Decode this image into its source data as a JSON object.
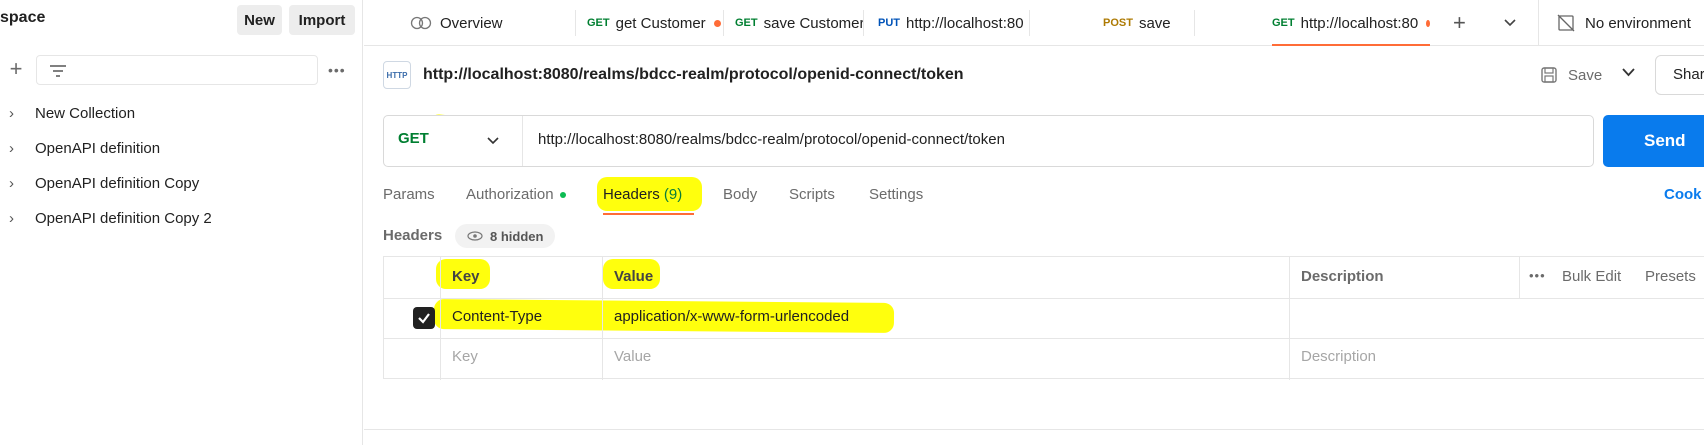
{
  "sidebar": {
    "workspace_title": "space",
    "new_label": "New",
    "import_label": "Import",
    "collections": [
      {
        "label": "New Collection"
      },
      {
        "label": "OpenAPI definition"
      },
      {
        "label": "OpenAPI definition Copy"
      },
      {
        "label": "OpenAPI definition Copy 2"
      }
    ]
  },
  "tabs": [
    {
      "method": "",
      "label": "Overview",
      "unsaved": false
    },
    {
      "method": "GET",
      "label": "get Customer",
      "unsaved": true
    },
    {
      "method": "GET",
      "label": "save Customer",
      "unsaved": true
    },
    {
      "method": "PUT",
      "label": "http://localhost:80",
      "unsaved": true
    },
    {
      "method": "POST",
      "label": "save",
      "unsaved": true
    },
    {
      "method": "GET",
      "label": "http://localhost:80",
      "unsaved": true,
      "active": true
    }
  ],
  "environment": "No environment",
  "request": {
    "icon_text": "HTTP",
    "title": "http://localhost:8080/realms/bdcc-realm/protocol/openid-connect/token",
    "save_label": "Save",
    "share_label": "Shar",
    "method": "GET",
    "url": "http://localhost:8080/realms/bdcc-realm/protocol/openid-connect/token",
    "send_label": "Send"
  },
  "subtabs": {
    "params": "Params",
    "authorization": "Authorization",
    "headers": "Headers",
    "headers_count": "(9)",
    "body": "Body",
    "scripts": "Scripts",
    "settings": "Settings",
    "cookies": "Cook"
  },
  "headers_section": {
    "label": "Headers",
    "hidden": "8 hidden",
    "columns": {
      "key": "Key",
      "value": "Value",
      "description": "Description"
    },
    "bulk_edit": "Bulk Edit",
    "presets": "Presets",
    "rows": [
      {
        "checked": true,
        "key": "Content-Type",
        "value": "application/x-www-form-urlencoded",
        "description": ""
      }
    ],
    "placeholder": {
      "key": "Key",
      "value": "Value",
      "description": "Description"
    }
  },
  "colors": {
    "accent": "#ff6c37",
    "send": "#097bed",
    "get": "#007f31",
    "highlight": "#ffff00"
  }
}
